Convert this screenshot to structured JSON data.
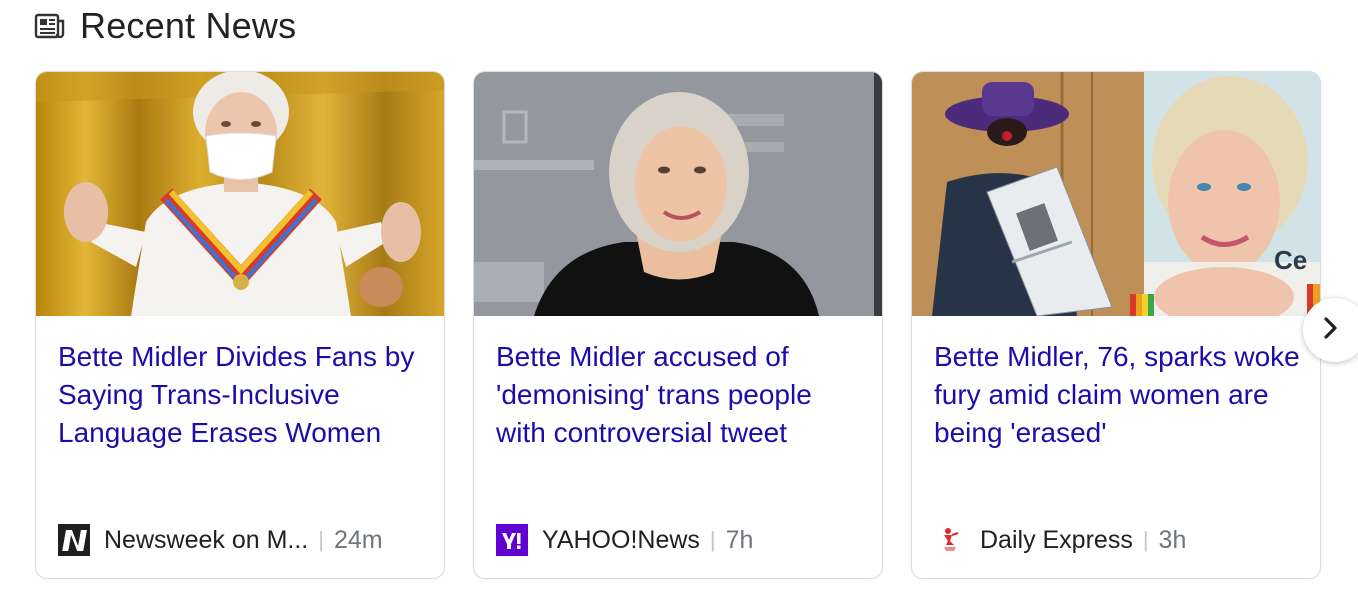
{
  "section": {
    "title": "Recent News",
    "icon": "newspaper-icon"
  },
  "cards": [
    {
      "title": "Bette Midler Divides Fans by Saying Trans-Inclusive Language Erases Women",
      "source": "Newsweek on M...",
      "source_icon": "newsweek-logo-icon",
      "age": "24m"
    },
    {
      "title": "Bette Midler accused of 'demonising' trans people with controversial tweet",
      "source": "YAHOO!News",
      "source_icon": "yahoo-logo-icon",
      "age": "7h"
    },
    {
      "title": "Bette Midler, 76, sparks woke fury amid claim women are being 'erased'",
      "source": "Daily Express",
      "source_icon": "daily-express-logo-icon",
      "age": "3h",
      "image_text": "Ce"
    }
  ],
  "carousel": {
    "next_icon": "chevron-right-icon"
  },
  "colors": {
    "headline_link": "#1a0dab",
    "yahoo_purple": "#6001d2",
    "divider": "#dadce0"
  }
}
